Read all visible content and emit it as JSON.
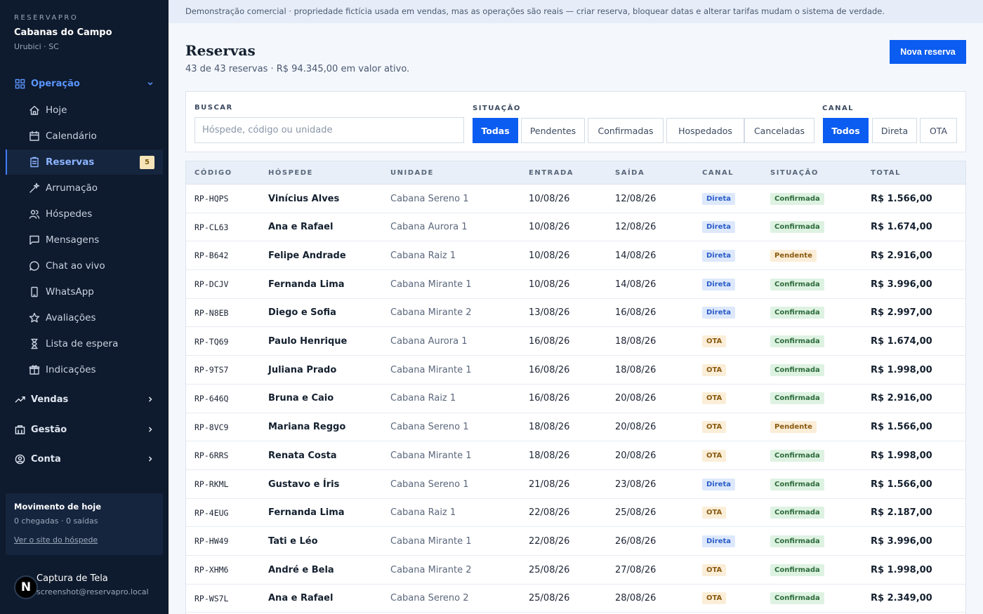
{
  "brand": {
    "eyebrow": "RESERVAPRO",
    "name": "Cabanas do Campo",
    "location": "Urubici · SC"
  },
  "nav": {
    "operacao": "Operação",
    "items": [
      {
        "label": "Hoje",
        "icon": "home-icon"
      },
      {
        "label": "Calendário",
        "icon": "calendar-icon"
      },
      {
        "label": "Reservas",
        "icon": "clipboard-icon",
        "badge": "5"
      },
      {
        "label": "Arrumação",
        "icon": "sparkles-icon"
      },
      {
        "label": "Hóspedes",
        "icon": "users-icon"
      },
      {
        "label": "Mensagens",
        "icon": "message-icon"
      },
      {
        "label": "Chat ao vivo",
        "icon": "chat-icon"
      },
      {
        "label": "WhatsApp",
        "icon": "phone-icon"
      },
      {
        "label": "Avaliações",
        "icon": "star-icon"
      },
      {
        "label": "Lista de espera",
        "icon": "hourglass-icon"
      },
      {
        "label": "Indicações",
        "icon": "gift-icon"
      }
    ],
    "vendas": "Vendas",
    "gestao": "Gestão",
    "conta": "Conta"
  },
  "today": {
    "title": "Movimento de hoje",
    "stats": "0 chegadas · 0 saídas",
    "link": "Ver o site do hóspede"
  },
  "user": {
    "initial": "N",
    "name": "Captura de Tela",
    "email": "screenshot@reservapro.local"
  },
  "banner": "Demonstração comercial · propriedade fictícia usada em vendas, mas as operações são reais — criar reserva, bloquear datas e alterar tarifas mudam o sistema de verdade.",
  "page": {
    "title": "Reservas",
    "subtitle": "43 de 43 reservas · R$ 94.345,00 em valor ativo.",
    "new_button": "Nova reserva"
  },
  "filters": {
    "search_label": "BUSCAR",
    "search_placeholder": "Hóspede, código ou unidade",
    "status_label": "SITUAÇÃO",
    "status_options": [
      "Todas",
      "Pendentes",
      "Confirmadas",
      "Hospedados",
      "Canceladas"
    ],
    "channel_label": "CANAL",
    "channel_options": [
      "Todos",
      "Direta",
      "OTA"
    ]
  },
  "table": {
    "headers": [
      "CÓDIGO",
      "HÓSPEDE",
      "UNIDADE",
      "ENTRADA",
      "SAÍDA",
      "CANAL",
      "SITUAÇÃO",
      "TOTAL"
    ],
    "rows": [
      {
        "code": "RP-HQPS",
        "guest": "Vinícius Alves",
        "unit": "Cabana Sereno 1",
        "in": "10/08/26",
        "out": "12/08/26",
        "channel": "Direta",
        "status": "Confirmada",
        "total": "R$ 1.566,00"
      },
      {
        "code": "RP-CL63",
        "guest": "Ana e Rafael",
        "unit": "Cabana Aurora 1",
        "in": "10/08/26",
        "out": "12/08/26",
        "channel": "Direta",
        "status": "Confirmada",
        "total": "R$ 1.674,00"
      },
      {
        "code": "RP-B642",
        "guest": "Felipe Andrade",
        "unit": "Cabana Raiz 1",
        "in": "10/08/26",
        "out": "14/08/26",
        "channel": "Direta",
        "status": "Pendente",
        "total": "R$ 2.916,00"
      },
      {
        "code": "RP-DCJV",
        "guest": "Fernanda Lima",
        "unit": "Cabana Mirante 1",
        "in": "10/08/26",
        "out": "14/08/26",
        "channel": "Direta",
        "status": "Confirmada",
        "total": "R$ 3.996,00"
      },
      {
        "code": "RP-N8EB",
        "guest": "Diego e Sofia",
        "unit": "Cabana Mirante 2",
        "in": "13/08/26",
        "out": "16/08/26",
        "channel": "Direta",
        "status": "Confirmada",
        "total": "R$ 2.997,00"
      },
      {
        "code": "RP-TQ69",
        "guest": "Paulo Henrique",
        "unit": "Cabana Aurora 1",
        "in": "16/08/26",
        "out": "18/08/26",
        "channel": "OTA",
        "status": "Confirmada",
        "total": "R$ 1.674,00"
      },
      {
        "code": "RP-9TS7",
        "guest": "Juliana Prado",
        "unit": "Cabana Mirante 1",
        "in": "16/08/26",
        "out": "18/08/26",
        "channel": "OTA",
        "status": "Confirmada",
        "total": "R$ 1.998,00"
      },
      {
        "code": "RP-646Q",
        "guest": "Bruna e Caio",
        "unit": "Cabana Raiz 1",
        "in": "16/08/26",
        "out": "20/08/26",
        "channel": "OTA",
        "status": "Confirmada",
        "total": "R$ 2.916,00"
      },
      {
        "code": "RP-8VC9",
        "guest": "Mariana Reggo",
        "unit": "Cabana Sereno 1",
        "in": "18/08/26",
        "out": "20/08/26",
        "channel": "OTA",
        "status": "Pendente",
        "total": "R$ 1.566,00"
      },
      {
        "code": "RP-6RRS",
        "guest": "Renata Costa",
        "unit": "Cabana Mirante 1",
        "in": "18/08/26",
        "out": "20/08/26",
        "channel": "OTA",
        "status": "Confirmada",
        "total": "R$ 1.998,00"
      },
      {
        "code": "RP-RKML",
        "guest": "Gustavo e Íris",
        "unit": "Cabana Sereno 1",
        "in": "21/08/26",
        "out": "23/08/26",
        "channel": "Direta",
        "status": "Confirmada",
        "total": "R$ 1.566,00"
      },
      {
        "code": "RP-4EUG",
        "guest": "Fernanda Lima",
        "unit": "Cabana Raiz 1",
        "in": "22/08/26",
        "out": "25/08/26",
        "channel": "OTA",
        "status": "Confirmada",
        "total": "R$ 2.187,00"
      },
      {
        "code": "RP-HW49",
        "guest": "Tati e Léo",
        "unit": "Cabana Mirante 1",
        "in": "22/08/26",
        "out": "26/08/26",
        "channel": "Direta",
        "status": "Confirmada",
        "total": "R$ 3.996,00"
      },
      {
        "code": "RP-XHM6",
        "guest": "André e Bela",
        "unit": "Cabana Mirante 2",
        "in": "25/08/26",
        "out": "27/08/26",
        "channel": "OTA",
        "status": "Confirmada",
        "total": "R$ 1.998,00"
      },
      {
        "code": "RP-WS7L",
        "guest": "Ana e Rafael",
        "unit": "Cabana Sereno 2",
        "in": "25/08/26",
        "out": "28/08/26",
        "channel": "OTA",
        "status": "Confirmada",
        "total": "R$ 2.349,00"
      }
    ]
  },
  "colors": {
    "sidebar_bg": "#0e1a2d",
    "accent": "#0b5cf0",
    "active_nav": "#8bb4ff"
  }
}
